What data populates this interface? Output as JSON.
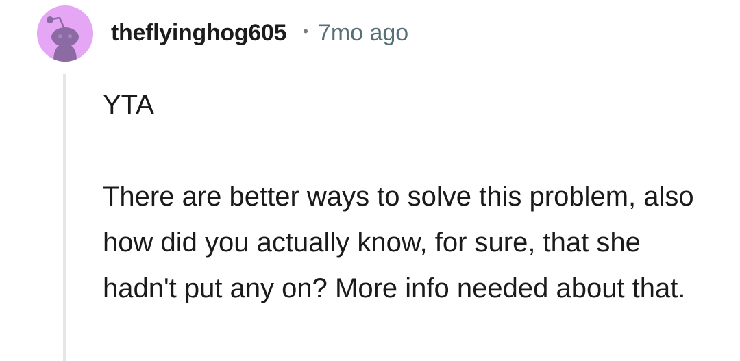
{
  "comment": {
    "username": "theflyinghog605",
    "separator": "•",
    "timestamp": "7mo ago",
    "avatar_icon": "reddit-snoo-avatar-icon",
    "avatar_color": "#e5a6f6",
    "body": {
      "verdict": "YTA",
      "text": "There are better ways to solve this problem, also how did you actually know, for sure, that she hadn't put any on? More info needed about that."
    }
  }
}
